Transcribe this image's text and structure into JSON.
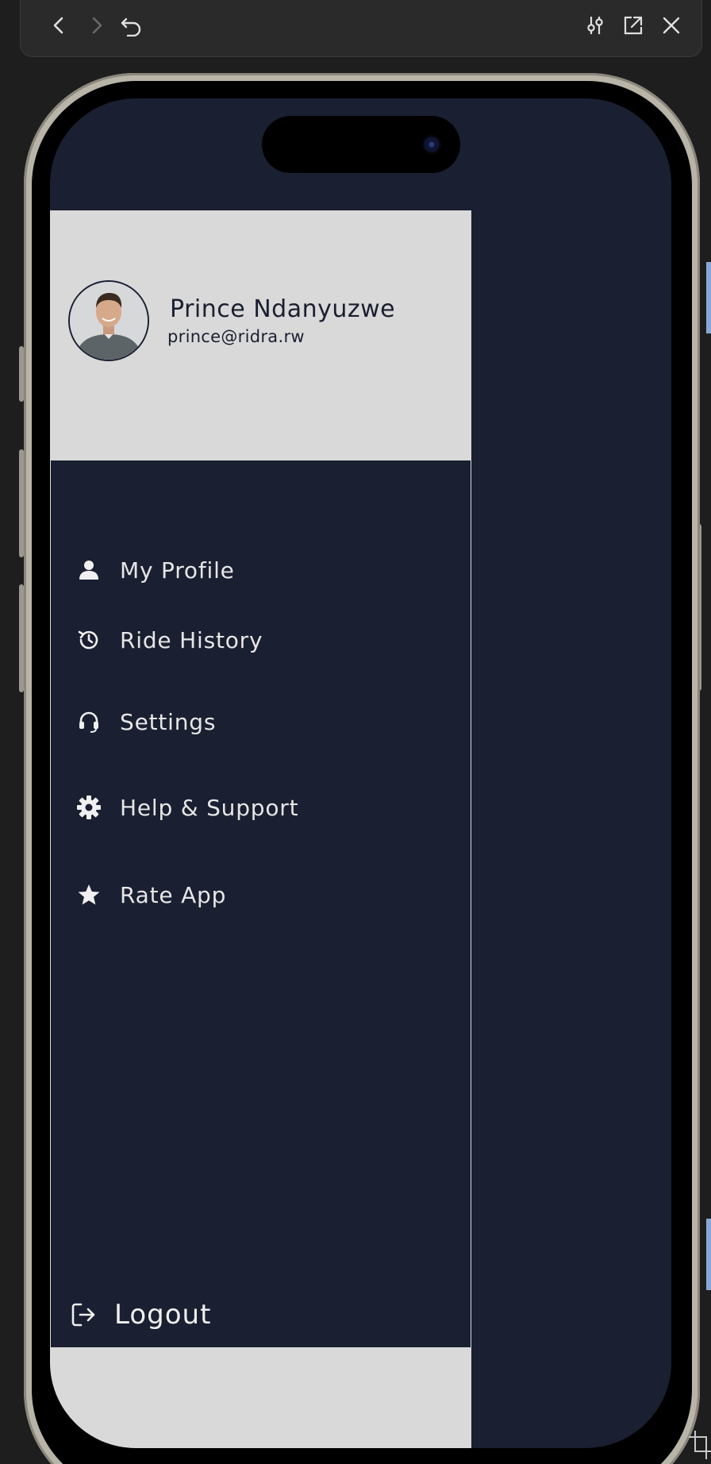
{
  "toolbar": {
    "back_icon": "chevron-left-icon",
    "forward_icon": "chevron-right-icon",
    "reload_icon": "undo-icon",
    "adjust_icon": "sliders-icon",
    "open_external_icon": "external-link-icon",
    "close_icon": "close-icon"
  },
  "drawer": {
    "user": {
      "name": "Prince Ndanyuzwe",
      "email": "prince@ridra.rw"
    },
    "menu": [
      {
        "label": "My Profile",
        "icon": "person-icon"
      },
      {
        "label": "Ride History",
        "icon": "history-icon"
      },
      {
        "label": "Settings",
        "icon": "headset-icon"
      },
      {
        "label": "Help & Support",
        "icon": "gear-icon"
      },
      {
        "label": "Rate App",
        "icon": "star-icon"
      }
    ],
    "logout_label": "Logout"
  },
  "colors": {
    "drawer_bg": "#1a1f31",
    "header_bg": "#d9d9d9",
    "text_light": "#e6e6e6"
  }
}
